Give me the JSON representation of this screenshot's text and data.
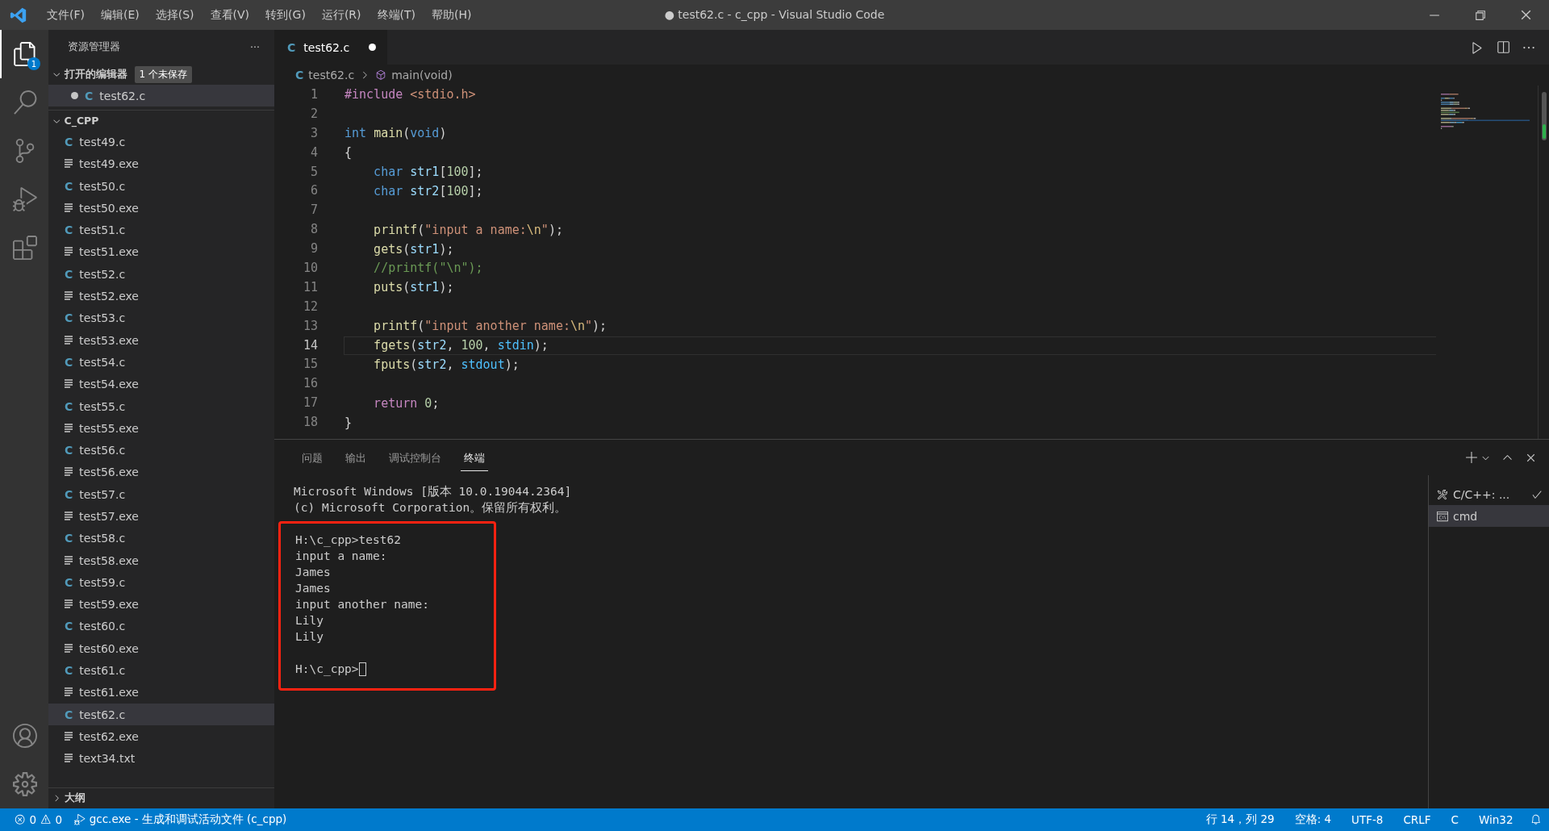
{
  "menu": [
    "文件(F)",
    "编辑(E)",
    "选择(S)",
    "查看(V)",
    "转到(G)",
    "运行(R)",
    "终端(T)",
    "帮助(H)"
  ],
  "window": {
    "title": "● test62.c - c_cpp - Visual Studio Code"
  },
  "activity": [
    {
      "kind": "files",
      "selected": true,
      "badge": "1"
    },
    {
      "kind": "search",
      "selected": false
    },
    {
      "kind": "git",
      "selected": false
    },
    {
      "kind": "debug",
      "selected": false
    },
    {
      "kind": "extensions",
      "selected": false
    }
  ],
  "sidebar": {
    "title": "资源管理器",
    "more": "···",
    "open_editors": {
      "label": "打开的编辑器",
      "badge": "1 个未保存",
      "expanded": true,
      "items": [
        {
          "name": "test62.c",
          "icon": "C",
          "dirty": true
        }
      ]
    },
    "folder": {
      "label": "C_CPP",
      "expanded": true,
      "items": [
        {
          "name": "test49.c",
          "kind": "c",
          "icon": "C",
          "selected": false
        },
        {
          "name": "test49.exe",
          "kind": "exe",
          "selected": false
        },
        {
          "name": "test50.c",
          "kind": "c",
          "icon": "C",
          "selected": false
        },
        {
          "name": "test50.exe",
          "kind": "exe",
          "selected": false
        },
        {
          "name": "test51.c",
          "kind": "c",
          "icon": "C",
          "selected": false
        },
        {
          "name": "test51.exe",
          "kind": "exe",
          "selected": false
        },
        {
          "name": "test52.c",
          "kind": "c",
          "icon": "C",
          "selected": false
        },
        {
          "name": "test52.exe",
          "kind": "exe",
          "selected": false
        },
        {
          "name": "test53.c",
          "kind": "c",
          "icon": "C",
          "selected": false
        },
        {
          "name": "test53.exe",
          "kind": "exe",
          "selected": false
        },
        {
          "name": "test54.c",
          "kind": "c",
          "icon": "C",
          "selected": false
        },
        {
          "name": "test54.exe",
          "kind": "exe",
          "selected": false
        },
        {
          "name": "test55.c",
          "kind": "c",
          "icon": "C",
          "selected": false
        },
        {
          "name": "test55.exe",
          "kind": "exe",
          "selected": false
        },
        {
          "name": "test56.c",
          "kind": "c",
          "icon": "C",
          "selected": false
        },
        {
          "name": "test56.exe",
          "kind": "exe",
          "selected": false
        },
        {
          "name": "test57.c",
          "kind": "c",
          "icon": "C",
          "selected": false
        },
        {
          "name": "test57.exe",
          "kind": "exe",
          "selected": false
        },
        {
          "name": "test58.c",
          "kind": "c",
          "icon": "C",
          "selected": false
        },
        {
          "name": "test58.exe",
          "kind": "exe",
          "selected": false
        },
        {
          "name": "test59.c",
          "kind": "c",
          "icon": "C",
          "selected": false
        },
        {
          "name": "test59.exe",
          "kind": "exe",
          "selected": false
        },
        {
          "name": "test60.c",
          "kind": "c",
          "icon": "C",
          "selected": false
        },
        {
          "name": "test60.exe",
          "kind": "exe",
          "selected": false
        },
        {
          "name": "test61.c",
          "kind": "c",
          "icon": "C",
          "selected": false
        },
        {
          "name": "test61.exe",
          "kind": "exe",
          "selected": false
        },
        {
          "name": "test62.c",
          "kind": "c",
          "icon": "C",
          "selected": true
        },
        {
          "name": "test62.exe",
          "kind": "exe",
          "selected": false
        },
        {
          "name": "text34.txt",
          "kind": "txt",
          "selected": false
        }
      ]
    },
    "outline": {
      "label": "大纲",
      "expanded": false
    }
  },
  "tabs": [
    {
      "name": "test62.c",
      "icon": "C",
      "selected": true,
      "dirty": true
    }
  ],
  "breadcrumb": [
    {
      "label": "test62.c",
      "kind": "file",
      "icon": "C"
    },
    {
      "label": "main(void)",
      "kind": "symbol"
    }
  ],
  "editor": {
    "lines": [
      {
        "number": "1",
        "current": false,
        "tokens": [
          {
            "text": "#include ",
            "kind": "keyword"
          },
          {
            "text": "<stdio.h>",
            "kind": "string"
          }
        ]
      },
      {
        "number": "2",
        "current": false
      },
      {
        "number": "3",
        "current": false,
        "tokens": [
          {
            "text": "int ",
            "kind": "type"
          },
          {
            "text": "main",
            "kind": "func"
          },
          {
            "text": "(",
            "kind": "plain"
          },
          {
            "text": "void",
            "kind": "type"
          },
          {
            "text": ")",
            "kind": "plain"
          }
        ]
      },
      {
        "number": "4",
        "current": false,
        "tokens": [
          {
            "text": "{",
            "kind": "plain"
          }
        ]
      },
      {
        "number": "5",
        "current": false,
        "tokens": [
          {
            "text": "    char ",
            "kind": "type"
          },
          {
            "text": "str1",
            "kind": "var"
          },
          {
            "text": "[",
            "kind": "plain"
          },
          {
            "text": "100",
            "kind": "number"
          },
          {
            "text": "];",
            "kind": "plain"
          }
        ]
      },
      {
        "number": "6",
        "current": false,
        "tokens": [
          {
            "text": "    char ",
            "kind": "type"
          },
          {
            "text": "str2",
            "kind": "var"
          },
          {
            "text": "[",
            "kind": "plain"
          },
          {
            "text": "100",
            "kind": "number"
          },
          {
            "text": "];",
            "kind": "plain"
          }
        ]
      },
      {
        "number": "7",
        "current": false
      },
      {
        "number": "8",
        "current": false,
        "tokens": [
          {
            "text": "    printf",
            "kind": "func"
          },
          {
            "text": "(",
            "kind": "plain"
          },
          {
            "text": "\"input a name:",
            "kind": "string"
          },
          {
            "text": "\\n",
            "kind": "escape"
          },
          {
            "text": "\"",
            "kind": "string"
          },
          {
            "text": ");",
            "kind": "plain"
          }
        ]
      },
      {
        "number": "9",
        "current": false,
        "tokens": [
          {
            "text": "    gets",
            "kind": "func"
          },
          {
            "text": "(",
            "kind": "plain"
          },
          {
            "text": "str1",
            "kind": "var"
          },
          {
            "text": ");",
            "kind": "plain"
          }
        ]
      },
      {
        "number": "10",
        "current": false,
        "tokens": [
          {
            "text": "    //printf(\"\\n\");",
            "kind": "comment"
          }
        ]
      },
      {
        "number": "11",
        "current": false,
        "tokens": [
          {
            "text": "    puts",
            "kind": "func"
          },
          {
            "text": "(",
            "kind": "plain"
          },
          {
            "text": "str1",
            "kind": "var"
          },
          {
            "text": ");",
            "kind": "plain"
          }
        ]
      },
      {
        "number": "12",
        "current": false
      },
      {
        "number": "13",
        "current": false,
        "tokens": [
          {
            "text": "    printf",
            "kind": "func"
          },
          {
            "text": "(",
            "kind": "plain"
          },
          {
            "text": "\"input another name:",
            "kind": "string"
          },
          {
            "text": "\\n",
            "kind": "escape"
          },
          {
            "text": "\"",
            "kind": "string"
          },
          {
            "text": ");",
            "kind": "plain"
          }
        ]
      },
      {
        "number": "14",
        "current": true,
        "tokens": [
          {
            "text": "    fgets",
            "kind": "func"
          },
          {
            "text": "(",
            "kind": "plain"
          },
          {
            "text": "str2",
            "kind": "var"
          },
          {
            "text": ", ",
            "kind": "plain"
          },
          {
            "text": "100",
            "kind": "number"
          },
          {
            "text": ", ",
            "kind": "plain"
          },
          {
            "text": "stdin",
            "kind": "macro"
          },
          {
            "text": ");",
            "kind": "plain"
          }
        ]
      },
      {
        "number": "15",
        "current": false,
        "tokens": [
          {
            "text": "    fputs",
            "kind": "func"
          },
          {
            "text": "(",
            "kind": "plain"
          },
          {
            "text": "str2",
            "kind": "var"
          },
          {
            "text": ", ",
            "kind": "plain"
          },
          {
            "text": "stdout",
            "kind": "macro"
          },
          {
            "text": ");",
            "kind": "plain"
          }
        ]
      },
      {
        "number": "16",
        "current": false
      },
      {
        "number": "17",
        "current": false,
        "tokens": [
          {
            "text": "    return ",
            "kind": "keyword"
          },
          {
            "text": "0",
            "kind": "number"
          },
          {
            "text": ";",
            "kind": "plain"
          }
        ]
      },
      {
        "number": "18",
        "current": false,
        "tokens": [
          {
            "text": "}",
            "kind": "plain"
          }
        ]
      }
    ]
  },
  "panel": {
    "tabs": [
      {
        "label": "问题",
        "selected": false
      },
      {
        "label": "输出",
        "selected": false
      },
      {
        "label": "调试控制台",
        "selected": false
      },
      {
        "label": "终端",
        "selected": true
      }
    ],
    "terminal": {
      "header": [
        "Microsoft Windows [版本 10.0.19044.2364]",
        "(c) Microsoft Corporation。保留所有权利。"
      ],
      "highlighted": [
        {
          "lines": [
            {
              "text": "H:\\c_cpp>test62",
              "cursor": false
            },
            {
              "text": "input a name:",
              "cursor": false
            },
            {
              "text": "James",
              "cursor": false
            },
            {
              "text": "James",
              "cursor": false
            },
            {
              "text": "input another name:",
              "cursor": false
            },
            {
              "text": "Lily",
              "cursor": false
            },
            {
              "text": "Lily",
              "cursor": false
            }
          ]
        },
        {
          "lines": [
            {
              "text": "H:\\c_cpp>",
              "cursor": true
            }
          ]
        }
      ]
    },
    "terminals": [
      {
        "label": "C/C++: ...",
        "kind": "task",
        "selected": false,
        "done": true
      },
      {
        "label": "cmd",
        "kind": "shell",
        "selected": true,
        "done": false
      }
    ]
  },
  "status_bar": {
    "errors": "0",
    "warnings": "0",
    "task": "gcc.exe - 生成和调试活动文件 (c_cpp)",
    "right": [
      "行 14，列 29",
      "空格: 4",
      "UTF-8",
      "CRLF",
      "C",
      "Win32"
    ]
  }
}
